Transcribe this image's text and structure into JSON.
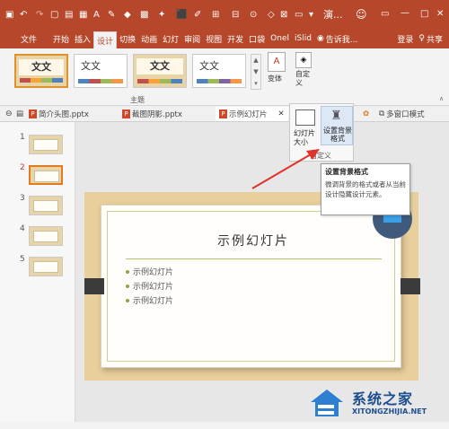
{
  "titlebar": {
    "app_title": "演...",
    "user_icon": "account-icon",
    "icons": [
      "save-icon",
      "undo-icon",
      "redo-icon",
      "new-file-icon",
      "open-icon",
      "layout-icon",
      "font-icon",
      "paint-icon",
      "shape-icon",
      "picture-icon",
      "wand-icon",
      "eraser-icon",
      "pen-icon",
      "grid-icon",
      "dropdown-icon"
    ]
  },
  "tabs": [
    "文件",
    "开始",
    "插入",
    "设计",
    "切换",
    "动画",
    "幻灯",
    "审阅",
    "视图",
    "开发",
    "口袋",
    "Onel",
    "iSlid"
  ],
  "active_tab": "设计",
  "tell_me": "告诉我...",
  "login": "登录",
  "share": "共享",
  "ribbon": {
    "themes": [
      "文文",
      "文文",
      "文文",
      "文文"
    ],
    "group_label": "主题",
    "variant_label": "变体",
    "custom_label": "自定义"
  },
  "doc_tabs": [
    {
      "name": "简介头图.pptx"
    },
    {
      "name": "截图阴影.pptx"
    },
    {
      "name": "示例幻灯片"
    }
  ],
  "multiwindow": "多窗口模式",
  "customize_dropdown": {
    "slide_size": "幻灯片大小",
    "bg_format": "设置背景格式",
    "group": "自定义"
  },
  "tooltip": {
    "title": "设置背景格式",
    "desc": "微调背景的格式或者从当前设计隐藏设计元素。"
  },
  "slides": [
    "1",
    "2",
    "3",
    "4",
    "5"
  ],
  "selected_slide": "2",
  "slide": {
    "title": "示例幻灯片",
    "bullets": [
      "示例幻灯片",
      "示例幻灯片",
      "示例幻灯片"
    ]
  },
  "watermark": {
    "name": "系统之家",
    "url": "XITONGZHIJIA.NET"
  },
  "colors": {
    "accent": "#b7472a",
    "arrow": "#e0312a"
  }
}
